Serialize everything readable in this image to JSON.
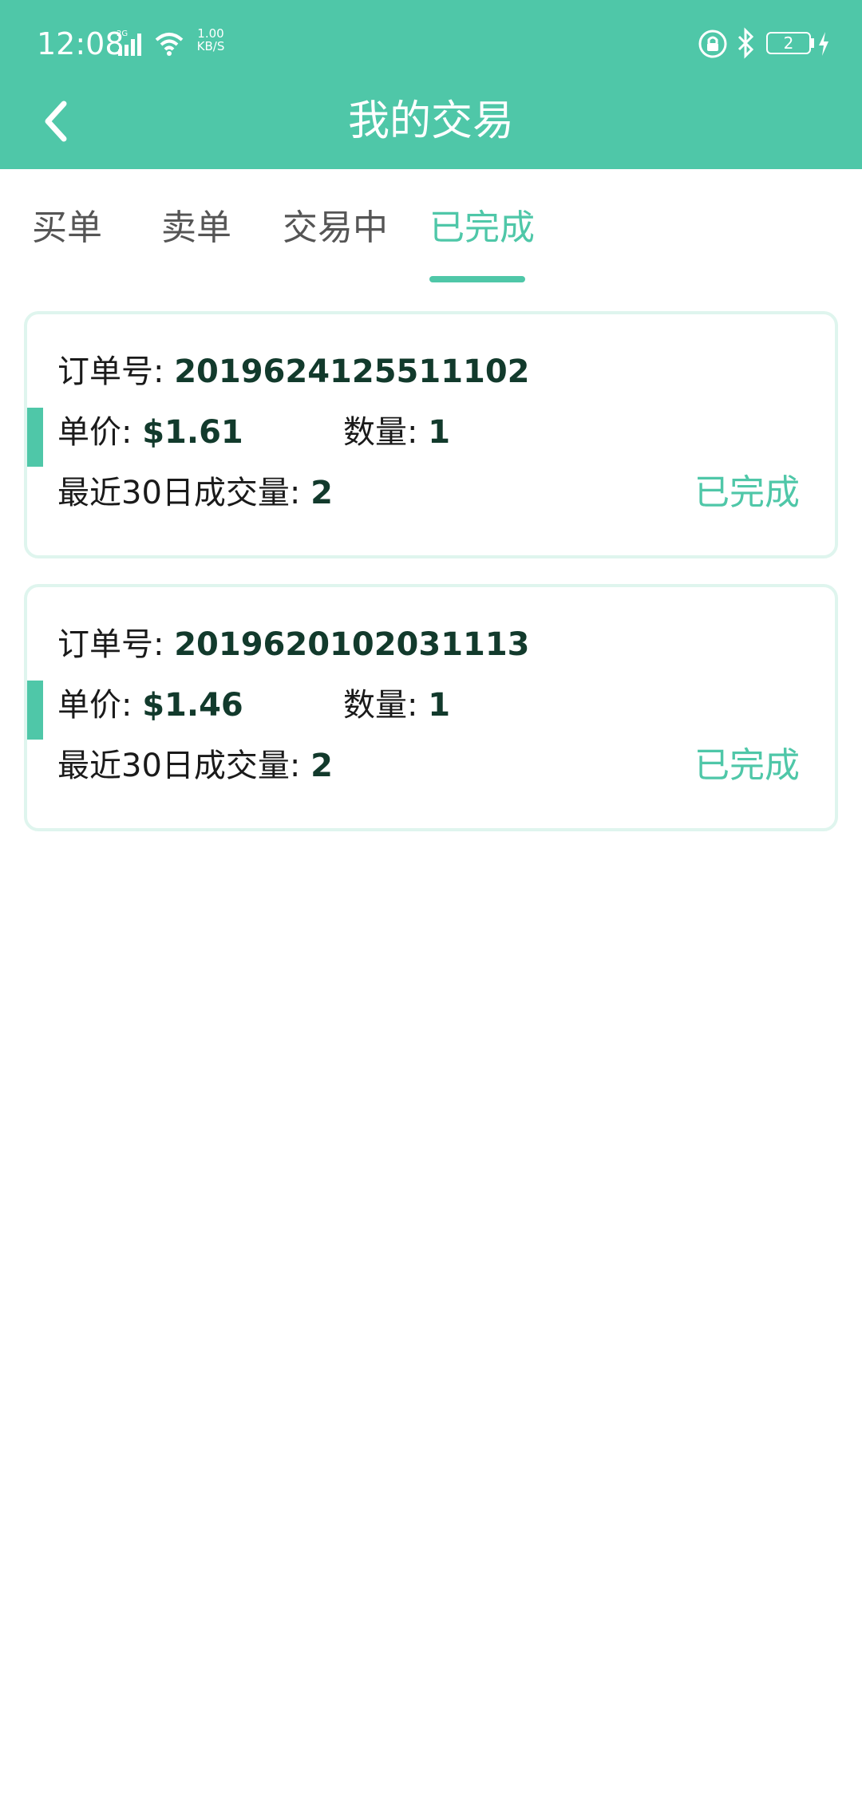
{
  "status_bar": {
    "time": "12:08",
    "network_type": "2G",
    "speed_value": "1.00",
    "speed_unit": "KB/S",
    "battery_level": "2"
  },
  "header": {
    "title": "我的交易"
  },
  "tabs": [
    {
      "label": "买单",
      "active": false
    },
    {
      "label": "卖单",
      "active": false
    },
    {
      "label": "交易中",
      "active": false
    },
    {
      "label": "已完成",
      "active": true
    }
  ],
  "labels": {
    "order_no": "订单号: ",
    "unit_price": "单价: ",
    "quantity": "数量: ",
    "volume_30d": "最近30日成交量: "
  },
  "orders": [
    {
      "order_no": "2019624125511102",
      "unit_price": "$1.61",
      "quantity": "1",
      "volume_30d": "2",
      "status": "已完成"
    },
    {
      "order_no": "2019620102031113",
      "unit_price": "$1.46",
      "quantity": "1",
      "volume_30d": "2",
      "status": "已完成"
    }
  ],
  "colors": {
    "brand": "#4fc7a8",
    "card_border": "#dff5ee",
    "text_dark": "#123a2c"
  },
  "icons": {
    "back": "chevron-left-icon",
    "signal": "signal-icon",
    "wifi": "wifi-icon",
    "lock": "lock-icon",
    "bluetooth": "bluetooth-icon",
    "charging": "charging-icon"
  }
}
